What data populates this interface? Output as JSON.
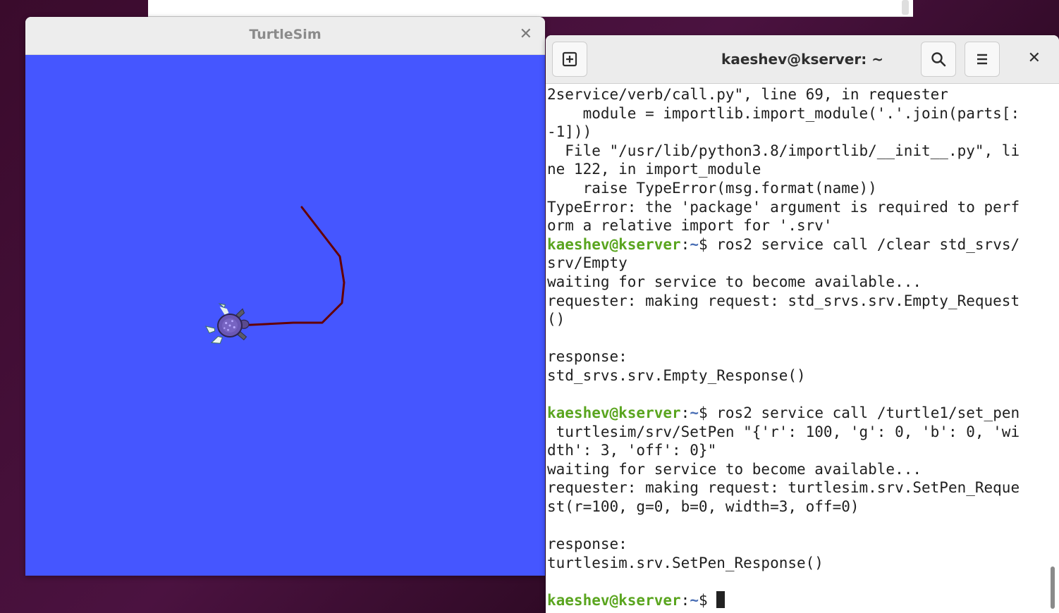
{
  "turtlesim": {
    "title": "TurtleSim",
    "close_icon": "✕",
    "background_color": "#4556ff",
    "pen_color": "#640000"
  },
  "terminal": {
    "title": "kaeshev@kserver: ~",
    "new_tab_icon": "new-tab-icon",
    "search_icon": "search-icon",
    "menu_icon": "hamburger-menu-icon",
    "close_icon": "✕",
    "prompt_user": "kaeshev@kserver",
    "prompt_sep": ":",
    "prompt_path": "~",
    "prompt_dollar": "$",
    "lines": [
      {
        "type": "out",
        "text": "2service/verb/call.py\", line 69, in requester"
      },
      {
        "type": "out",
        "text": "    module = importlib.import_module('.'.join(parts[:"
      },
      {
        "type": "out",
        "text": "-1]))"
      },
      {
        "type": "out",
        "text": "  File \"/usr/lib/python3.8/importlib/__init__.py\", li"
      },
      {
        "type": "out",
        "text": "ne 122, in import_module"
      },
      {
        "type": "out",
        "text": "    raise TypeError(msg.format(name))"
      },
      {
        "type": "out",
        "text": "TypeError: the 'package' argument is required to perf"
      },
      {
        "type": "out",
        "text": "orm a relative import for '.srv'"
      },
      {
        "type": "cmd",
        "text": " ros2 service call /clear std_srvs/"
      },
      {
        "type": "out",
        "text": "srv/Empty"
      },
      {
        "type": "out",
        "text": "waiting for service to become available..."
      },
      {
        "type": "out",
        "text": "requester: making request: std_srvs.srv.Empty_Request"
      },
      {
        "type": "out",
        "text": "()"
      },
      {
        "type": "out",
        "text": ""
      },
      {
        "type": "out",
        "text": "response:"
      },
      {
        "type": "out",
        "text": "std_srvs.srv.Empty_Response()"
      },
      {
        "type": "out",
        "text": ""
      },
      {
        "type": "cmd",
        "text": " ros2 service call /turtle1/set_pen"
      },
      {
        "type": "out",
        "text": " turtlesim/srv/SetPen \"{'r': 100, 'g': 0, 'b': 0, 'wi"
      },
      {
        "type": "out",
        "text": "dth': 3, 'off': 0}\""
      },
      {
        "type": "out",
        "text": "waiting for service to become available..."
      },
      {
        "type": "out",
        "text": "requester: making request: turtlesim.srv.SetPen_Reque"
      },
      {
        "type": "out",
        "text": "st(r=100, g=0, b=0, width=3, off=0)"
      },
      {
        "type": "out",
        "text": ""
      },
      {
        "type": "out",
        "text": "response:"
      },
      {
        "type": "out",
        "text": "turtlesim.srv.SetPen_Response()"
      },
      {
        "type": "out",
        "text": ""
      },
      {
        "type": "prompt",
        "text": " "
      }
    ]
  }
}
